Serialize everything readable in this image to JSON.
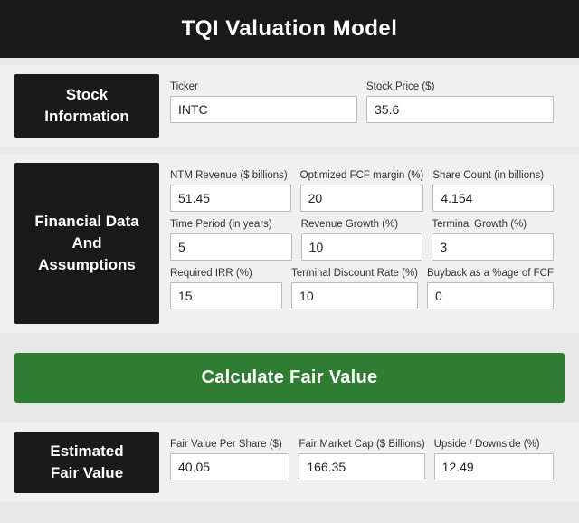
{
  "header": {
    "title": "TQI Valuation Model"
  },
  "stock_information": {
    "label": "Stock\nInformation",
    "ticker_label": "Ticker",
    "ticker_value": "INTC",
    "stock_price_label": "Stock Price ($)",
    "stock_price_value": "35.6"
  },
  "financial_data": {
    "label": "Financial Data\nAnd\nAssumptions",
    "row1": {
      "ntm_revenue_label": "NTM Revenue ($ billions)",
      "ntm_revenue_value": "51.45",
      "optimized_fcf_label": "Optimized FCF margin (%)",
      "optimized_fcf_value": "20",
      "share_count_label": "Share Count (in billions)",
      "share_count_value": "4.154"
    },
    "row2": {
      "time_period_label": "Time Period (in years)",
      "time_period_value": "5",
      "revenue_growth_label": "Revenue Growth (%)",
      "revenue_growth_value": "10",
      "terminal_growth_label": "Terminal Growth (%)",
      "terminal_growth_value": "3"
    },
    "row3": {
      "required_irr_label": "Required IRR (%)",
      "required_irr_value": "15",
      "terminal_discount_label": "Terminal Discount Rate (%)",
      "terminal_discount_value": "10",
      "buyback_label": "Buyback as a %age of FCF",
      "buyback_value": "0"
    }
  },
  "calculate_button": {
    "label": "Calculate Fair Value"
  },
  "estimated_fair_value": {
    "label": "Estimated\nFair Value",
    "fair_value_per_share_label": "Fair Value Per Share ($)",
    "fair_value_per_share_value": "40.05",
    "fair_market_cap_label": "Fair Market Cap ($ Billions)",
    "fair_market_cap_value": "166.35",
    "upside_downside_label": "Upside / Downside (%)",
    "upside_downside_value": "12.49"
  }
}
